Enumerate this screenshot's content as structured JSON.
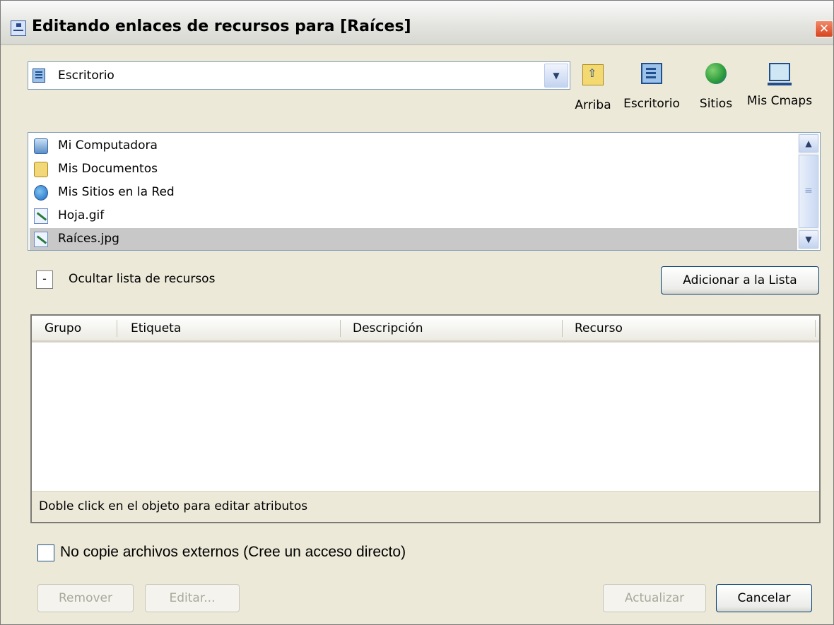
{
  "window": {
    "title": "Editando enlaces de recursos para [Raíces]",
    "close_glyph": "✕"
  },
  "location": {
    "value": "Escritorio",
    "dropdown_glyph": "▼"
  },
  "toolbar": [
    {
      "label": "Arriba",
      "icon": "folder-up-icon"
    },
    {
      "label": "Escritorio",
      "icon": "desktop-icon"
    },
    {
      "label": "Sitios",
      "icon": "globe-icon"
    },
    {
      "label": "Mis Cmaps",
      "icon": "computer-icon"
    }
  ],
  "files": [
    {
      "label": "Mi Computadora",
      "icon": "computer-icon",
      "selected": false
    },
    {
      "label": "Mis Documentos",
      "icon": "documents-folder-icon",
      "selected": false
    },
    {
      "label": "Mis Sitios en la Red",
      "icon": "network-icon",
      "selected": false
    },
    {
      "label": "Hoja.gif",
      "icon": "image-file-icon",
      "selected": false
    },
    {
      "label": "Raíces.jpg",
      "icon": "image-file-icon",
      "selected": true
    }
  ],
  "scrollbar": {
    "up": "▲",
    "down": "▼",
    "grip": "≡"
  },
  "resource_toggle": {
    "glyph": "-",
    "label": "Ocultar lista de recursos"
  },
  "add_button": "Adicionar a la Lista",
  "table": {
    "columns": [
      "Grupo",
      "Etiqueta",
      "Descripción",
      "Recurso"
    ],
    "rows": [],
    "status": "Doble click en el objeto para editar atributos"
  },
  "options": {
    "no_copy_label": "No copie archivos externos (Cree un acceso directo)",
    "no_copy_checked": false
  },
  "buttons": {
    "remove": "Remover",
    "edit": "Editar...",
    "update": "Actualizar",
    "cancel": "Cancelar"
  }
}
